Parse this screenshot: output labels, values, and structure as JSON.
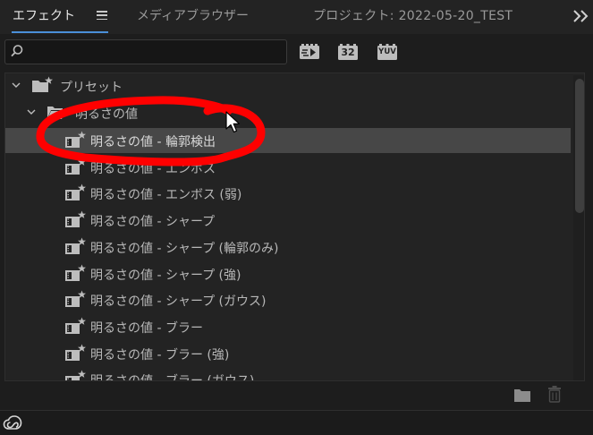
{
  "tabs": {
    "effects": "エフェクト",
    "media_browser": "メディアブラウザー",
    "project": "プロジェクト: 2022-05-20_TEST"
  },
  "toolbar": {
    "search_value": "",
    "filters": [
      "accelerated-effects-filter-icon",
      "32-bit-filter-icon",
      "yuv-filter-icon"
    ],
    "badge_32": "32",
    "badge_yuv": "YUV"
  },
  "tree": {
    "root": {
      "label": "プリセット",
      "expanded": true
    },
    "folder": {
      "label": "明るさの値",
      "expanded": true
    },
    "items": [
      "明るさの値 - 輪郭検出",
      "明るさの値 - エンボス",
      "明るさの値 - エンボス (弱)",
      "明るさの値 - シャープ",
      "明るさの値 - シャープ (輪郭のみ)",
      "明るさの値 - シャープ (強)",
      "明るさの値 - シャープ (ガウス)",
      "明るさの値 - ブラー",
      "明るさの値 - ブラー (強)",
      "明るさの値 - ブラー (ガウス)"
    ],
    "selected_index": 0
  },
  "colors": {
    "accent": "#4a8fd8",
    "annotation": "#ff0000",
    "selection": "#474747"
  }
}
